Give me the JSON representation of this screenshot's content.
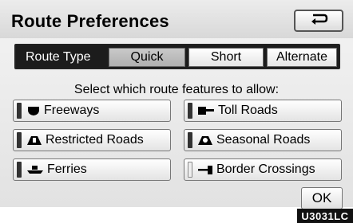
{
  "header": {
    "title": "Route Preferences",
    "back_icon": "return-arrow-icon"
  },
  "route_type": {
    "label": "Route Type",
    "options": [
      "Quick",
      "Short",
      "Alternate"
    ],
    "selected": "Quick"
  },
  "prompt": "Select which route features to allow:",
  "features": [
    {
      "label": "Freeways",
      "icon": "freeway-icon",
      "enabled": true
    },
    {
      "label": "Toll Roads",
      "icon": "toll-road-icon",
      "enabled": true
    },
    {
      "label": "Restricted Roads",
      "icon": "restricted-road-icon",
      "enabled": true
    },
    {
      "label": "Seasonal Roads",
      "icon": "seasonal-road-icon",
      "enabled": true
    },
    {
      "label": "Ferries",
      "icon": "ferry-icon",
      "enabled": true
    },
    {
      "label": "Border Crossings",
      "icon": "border-crossing-icon",
      "enabled": false
    }
  ],
  "ok_label": "OK",
  "figure_code": "U3031LC"
}
